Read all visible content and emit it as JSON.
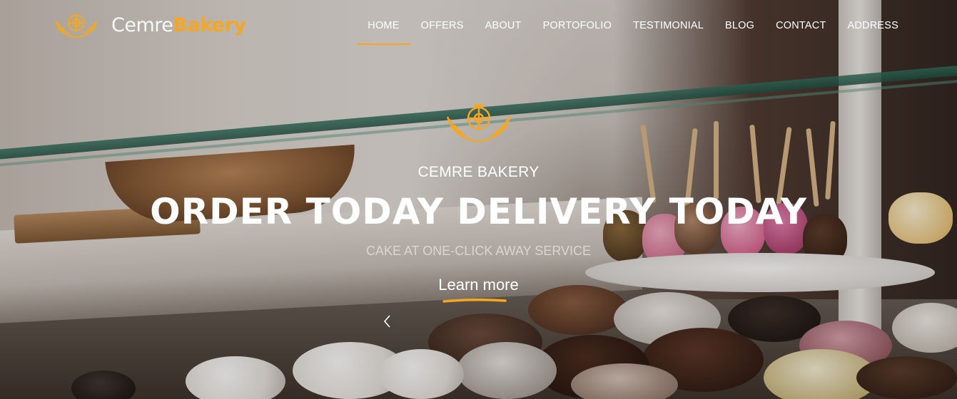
{
  "brand": {
    "name_part1": "Cemre",
    "name_part2": "Bakery"
  },
  "nav": {
    "items": [
      {
        "label": "HOME",
        "active": true
      },
      {
        "label": "OFFERS",
        "active": false
      },
      {
        "label": "ABOUT",
        "active": false
      },
      {
        "label": "PORTOFOLIO",
        "active": false
      },
      {
        "label": "TESTIMONIAL",
        "active": false
      },
      {
        "label": "BLOG",
        "active": false
      },
      {
        "label": "CONTACT",
        "active": false
      },
      {
        "label": "ADDRESS",
        "active": false
      }
    ]
  },
  "hero": {
    "subtitle": "CEMRE BAKERY",
    "headline": "ORDER TODAY DELIVERY TODAY",
    "tagline": "CAKE AT ONE-CLICK AWAY SERVICE",
    "cta_label": "Learn more"
  },
  "icons": {
    "logo": "bakery-logo-icon",
    "hero_mark": "bakery-emblem-icon",
    "prev": "chevron-left-icon"
  },
  "colors": {
    "accent": "#f5a623",
    "text_light": "#ffffff"
  }
}
